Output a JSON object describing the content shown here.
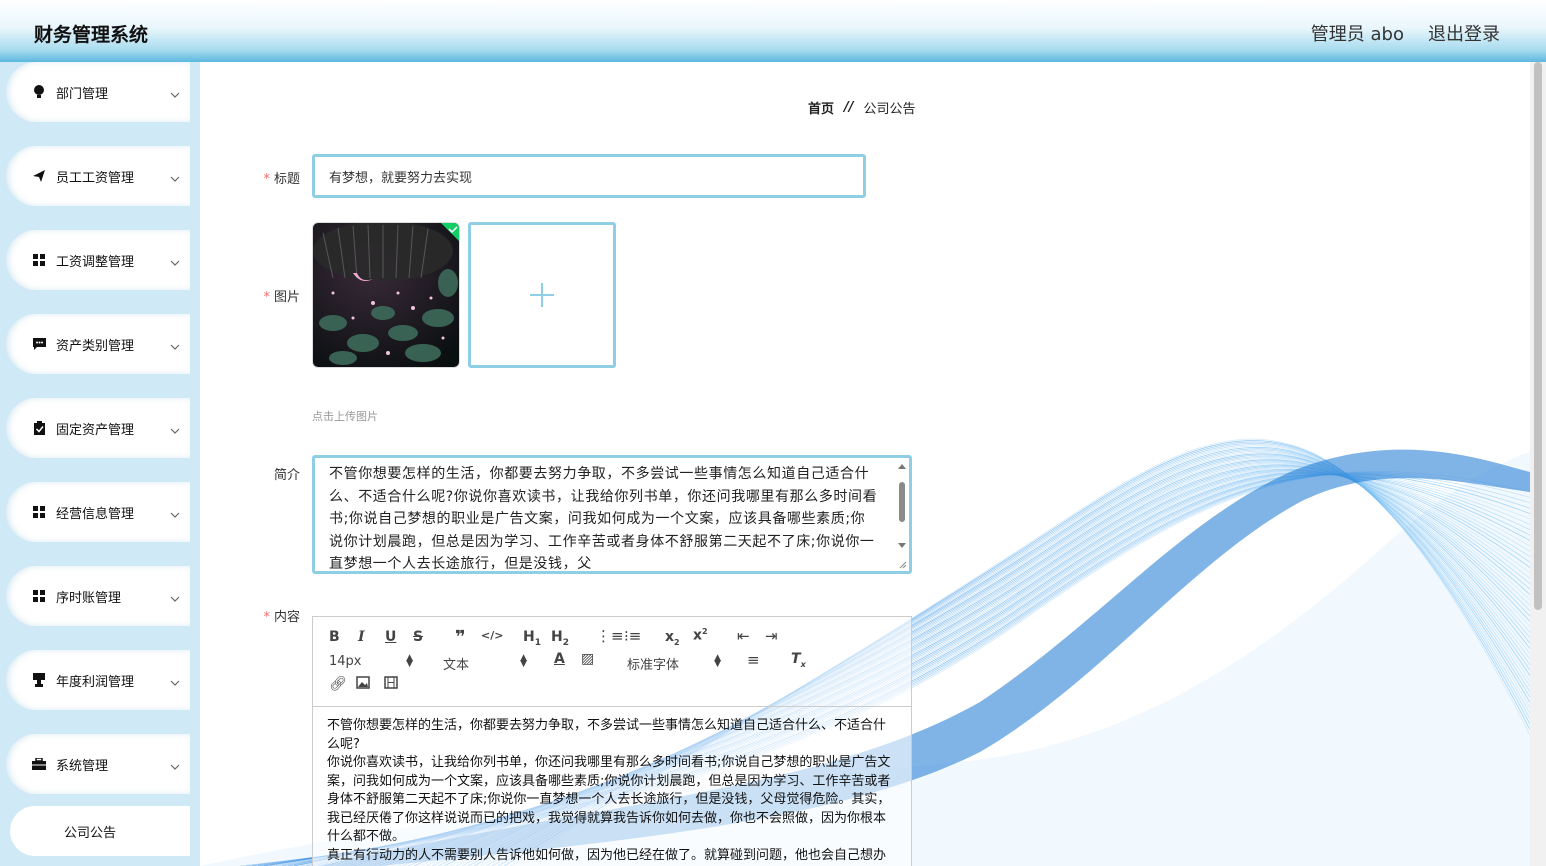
{
  "app": {
    "title": "财务管理系统"
  },
  "header": {
    "user": "管理员 abo",
    "logout": "退出登录"
  },
  "sidebar": {
    "items": [
      {
        "label": "部门管理",
        "icon": "bulb-icon"
      },
      {
        "label": "员工工资管理",
        "icon": "paper-plane-icon"
      },
      {
        "label": "工资调整管理",
        "icon": "grid-icon"
      },
      {
        "label": "资产类别管理",
        "icon": "message-icon"
      },
      {
        "label": "固定资产管理",
        "icon": "clipboard-icon"
      },
      {
        "label": "经营信息管理",
        "icon": "grid-icon"
      },
      {
        "label": "序时账管理",
        "icon": "grid-icon"
      },
      {
        "label": "年度利润管理",
        "icon": "trophy-icon"
      },
      {
        "label": "系统管理",
        "icon": "briefcase-icon"
      }
    ],
    "active_sub": "公司公告"
  },
  "breadcrumb": {
    "home": "首页",
    "sep": "//",
    "current": "公司公告"
  },
  "form": {
    "title_label": "标题",
    "title_value": "有梦想，就要努力去实现",
    "image_label": "图片",
    "upload_hint": "点击上传图片",
    "intro_label": "简介",
    "intro_value": "不管你想要怎样的生活，你都要去努力争取，不多尝试一些事情怎么知道自己适合什么、不适合什么呢?你说你喜欢读书，让我给你列书单，你还问我哪里有那么多时间看书;你说自己梦想的职业是广告文案，问我如何成为一个文案，应该具备哪些素质;你说你计划晨跑，但总是因为学习、工作辛苦或者身体不舒服第二天起不了床;你说你一直梦想一个人去长途旅行，但是没钱，父",
    "content_label": "内容"
  },
  "editor": {
    "font_size": "14px",
    "header_select": "文本",
    "font_family": "标准字体",
    "paragraphs": [
      "不管你想要怎样的生活，你都要去努力争取，不多尝试一些事情怎么知道自己适合什么、不适合什么呢?",
      "你说你喜欢读书，让我给你列书单，你还问我哪里有那么多时间看书;你说自己梦想的职业是广告文案，问我如何成为一个文案，应该具备哪些素质;你说你计划晨跑，但总是因为学习、工作辛苦或者身体不舒服第二天起不了床;你说你一直梦想一个人去长途旅行，但是没钱，父母觉得危险。其实，我已经厌倦了你这样说说而已的把戏，我觉得就算我告诉你如何去做，你也不会照做，因为你根本什么都不做。",
      "真正有行动力的人不需要别人告诉他如何做，因为他已经在做了。就算碰到问题，他也会自己想办"
    ]
  },
  "colors": {
    "accent": "#8fcfe5",
    "sidebar_bg": "#cfe9f6",
    "required": "#f56c6c"
  }
}
